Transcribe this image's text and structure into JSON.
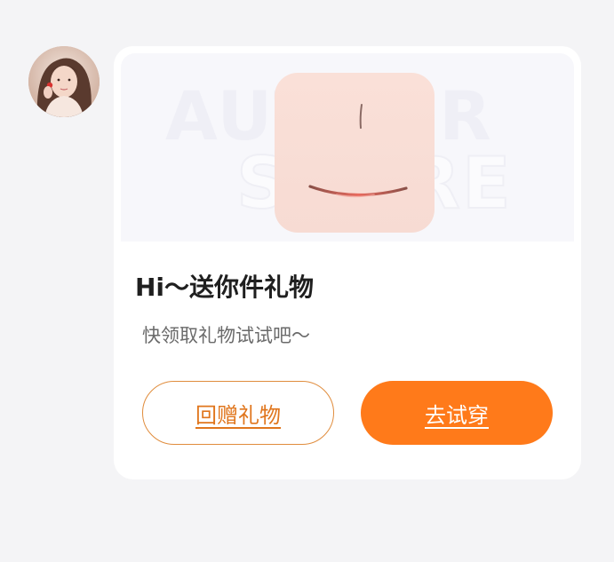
{
  "sender": {
    "avatar_icon": "user-avatar-photo"
  },
  "gift_card": {
    "watermark_line1": "AUTHOR",
    "watermark_line2": "SCORE",
    "gift_image_icon": "smiling-face-icon",
    "title": "Hi～送你件礼物",
    "subtitle": "快领取礼物试试吧～",
    "gift_back_label": "回赠礼物",
    "try_on_label": "去试穿"
  },
  "colors": {
    "accent": "#ff7a1a",
    "outline_text": "#e0761d",
    "background": "#f4f4f6",
    "card": "#ffffff"
  }
}
